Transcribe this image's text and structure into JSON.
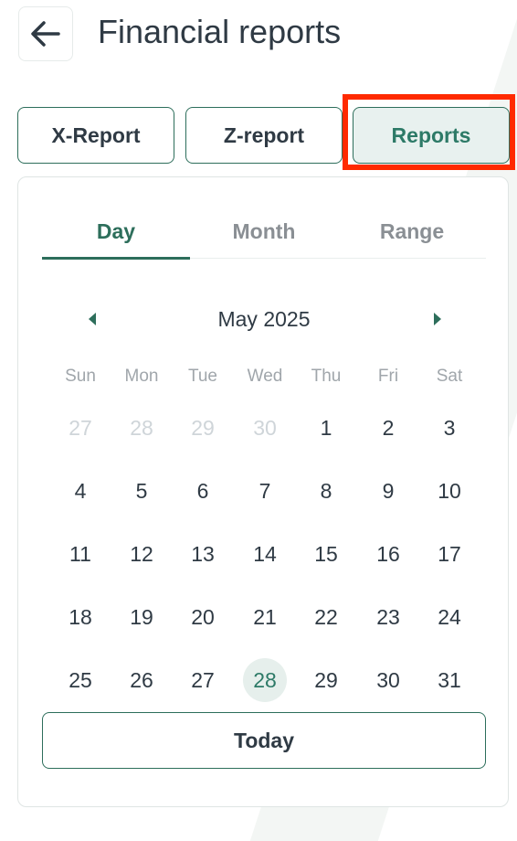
{
  "header": {
    "title": "Financial reports",
    "back_icon": "arrow-left-icon"
  },
  "report_tabs": [
    {
      "label": "X-Report",
      "active": false
    },
    {
      "label": "Z-report",
      "active": false
    },
    {
      "label": "Reports",
      "active": true
    }
  ],
  "period_tabs": [
    {
      "label": "Day",
      "active": true
    },
    {
      "label": "Month",
      "active": false
    },
    {
      "label": "Range",
      "active": false
    }
  ],
  "calendar": {
    "month_label": "May 2025",
    "prev_icon": "caret-left-icon",
    "next_icon": "caret-right-icon",
    "weekdays": [
      "Sun",
      "Mon",
      "Tue",
      "Wed",
      "Thu",
      "Fri",
      "Sat"
    ],
    "weeks": [
      [
        "27",
        "28",
        "29",
        "30",
        "1",
        "2",
        "3"
      ],
      [
        "4",
        "5",
        "6",
        "7",
        "8",
        "9",
        "10"
      ],
      [
        "11",
        "12",
        "13",
        "14",
        "15",
        "16",
        "17"
      ],
      [
        "18",
        "19",
        "20",
        "21",
        "22",
        "23",
        "24"
      ],
      [
        "25",
        "26",
        "27",
        "28",
        "29",
        "30",
        "31"
      ]
    ],
    "muted_days_first_week": 4,
    "selected_day": "28"
  },
  "today_button": {
    "label": "Today"
  },
  "colors": {
    "accent": "#2d6e5b",
    "highlight_box": "#ff2a00"
  }
}
